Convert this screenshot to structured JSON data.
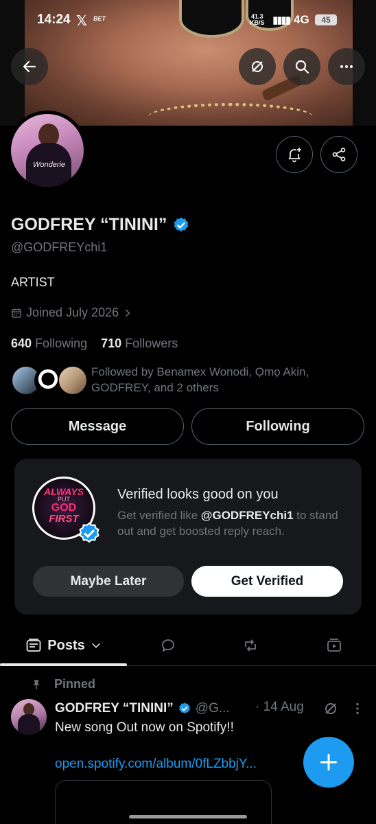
{
  "status_bar": {
    "time": "14:24",
    "x_logo": "𝕏",
    "bet_app": "BET",
    "speed_value": "41.3",
    "speed_unit": "KB/S",
    "network": "4G",
    "battery": "45"
  },
  "top_actions": {
    "back_icon": "arrow-left-icon",
    "grok_icon": "grok-icon",
    "search_icon": "search-icon",
    "more_icon": "more-horizontal-icon"
  },
  "profile": {
    "display_name": "GODFREY “TININI”",
    "handle": "@GODFREYchi1",
    "bio": "ARTIST",
    "joined": "Joined July 2026",
    "following_count": "640",
    "following_label": "Following",
    "followers_count": "710",
    "followers_label": "Followers",
    "followed_by_line1": "Followed by Benamex Wonodi, Ọmọ Akin,",
    "followed_by_line2": "GODFREY, and 2 others",
    "avatar_script": "Wonderie"
  },
  "buttons": {
    "message": "Message",
    "following": "Following"
  },
  "verify_card": {
    "title": "Verified looks good on you",
    "desc_prefix": "Get verified like ",
    "desc_handle": "@GODFREYchi1",
    "desc_suffix": " to stand out and get boosted reply reach.",
    "logo_line1": "ALWAYS",
    "logo_line2": "PUT",
    "logo_line3": "GOD",
    "logo_line4": "FIRST",
    "maybe_later": "Maybe Later",
    "get_verified": "Get Verified"
  },
  "tabs": {
    "posts": "Posts"
  },
  "post": {
    "pinned_label": "Pinned",
    "author_name": "GODFREY “TININI”",
    "author_handle": "@G...",
    "date": "· 14 Aug",
    "text": "New song Out now on Spotify!!",
    "link": "open.spotify.com/album/0fLZbbjY..."
  },
  "colors": {
    "accent": "#1d9bf0",
    "background": "#000000",
    "secondary_text": "#71767b",
    "card": "#16181c"
  }
}
